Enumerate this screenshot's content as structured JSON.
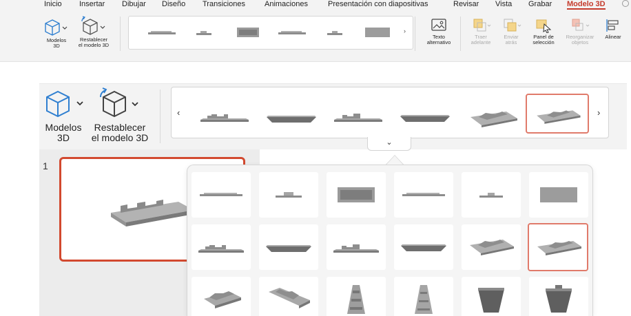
{
  "menu": {
    "items": [
      "Inicio",
      "Insertar",
      "Dibujar",
      "Diseño",
      "Transiciones",
      "Animaciones",
      "Presentación con diapositivas",
      "Revisar",
      "Vista",
      "Grabar",
      "Modelo 3D"
    ],
    "active": "Modelo 3D"
  },
  "toolbar": {
    "models": {
      "line1": "Modelos",
      "line2": "3D"
    },
    "reset": {
      "line1": "Restablecer",
      "line2": "el modelo 3D"
    },
    "alt_text": {
      "line1": "Texto",
      "line2": "alternativo"
    },
    "bring_forward": {
      "line1": "Traer",
      "line2": "adelante"
    },
    "send_backward": {
      "line1": "Enviar",
      "line2": "atrás"
    },
    "selection_pane": {
      "line1": "Panel de",
      "line2": "selección"
    },
    "reorder": {
      "line1": "Reorganizar",
      "line2": "objetos"
    },
    "align": {
      "line1": "Alinear"
    }
  },
  "zoom_ribbon": {
    "models": {
      "line1": "Modelos",
      "line2": "3D"
    },
    "reset": {
      "line1": "Restablecer",
      "line2": "el modelo 3D"
    },
    "prev_glyph": "‹",
    "next_glyph": "›",
    "expand_glyph": "⌄"
  },
  "slides": {
    "number": "1"
  },
  "colors": {
    "accent": "#c53a2b",
    "selection": "#e07a6a",
    "model": "#9a9a9a"
  }
}
